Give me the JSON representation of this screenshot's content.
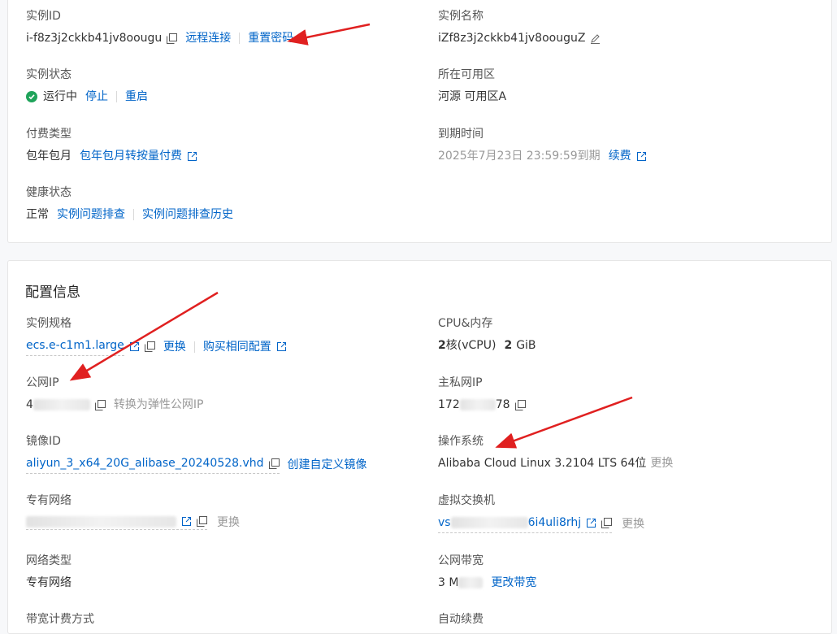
{
  "basic": {
    "instance_id": {
      "label": "实例ID",
      "value": "i-f8z3j2ckkb41jv8oougu",
      "remote_link": "远程连接",
      "reset_link": "重置密码"
    },
    "instance_name": {
      "label": "实例名称",
      "value": "iZf8z3j2ckkb41jv8oouguZ"
    },
    "status": {
      "label": "实例状态",
      "value": "运行中",
      "stop": "停止",
      "restart": "重启",
      "ok_color": "#1fa35a"
    },
    "zone": {
      "label": "所在可用区",
      "value": "河源 可用区A"
    },
    "billing": {
      "label": "付费类型",
      "value": "包年包月",
      "convert_link": "包年包月转按量付费"
    },
    "expire": {
      "label": "到期时间",
      "value": "2025年7月23日 23:59:59到期",
      "renew_link": "续费"
    },
    "health": {
      "label": "健康状态",
      "value": "正常",
      "diagnose_link": "实例问题排查",
      "history_link": "实例问题排查历史"
    }
  },
  "config": {
    "title": "配置信息",
    "spec": {
      "label": "实例规格",
      "value": "ecs.e-c1m1.large",
      "change": "更换",
      "buy_same": "购买相同配置"
    },
    "cpu_mem": {
      "label": "CPU&内存",
      "cpu_num": "2",
      "cpu_unit": "核(vCPU)",
      "mem_num": "2",
      "mem_unit": "GiB"
    },
    "public_ip": {
      "label": "公网IP",
      "value_prefix": "4",
      "convert": "转换为弹性公网IP"
    },
    "private_ip": {
      "label": "主私网IP",
      "value_prefix": "172",
      "value_suffix": "78"
    },
    "image_id": {
      "label": "镜像ID",
      "value": "aliyun_3_x64_20G_alibase_20240528.vhd",
      "create_link": "创建自定义镜像"
    },
    "os": {
      "label": "操作系统",
      "value": "Alibaba Cloud Linux 3.2104 LTS 64位",
      "change": "更换"
    },
    "vpc": {
      "label": "专有网络",
      "change": "更换"
    },
    "vswitch": {
      "label": "虚拟交换机",
      "value_prefix": "vs",
      "value_suffix": "6i4uli8rhj",
      "change": "更换"
    },
    "net_type": {
      "label": "网络类型",
      "value": "专有网络"
    },
    "bandwidth": {
      "label": "公网带宽",
      "value_prefix": "3 M",
      "change_link": "更改带宽"
    },
    "bw_billing": {
      "label": "带宽计费方式"
    },
    "auto_renew": {
      "label": "自动续费"
    }
  },
  "colors": {
    "link": "#0064c8",
    "arrow": "#e02020"
  }
}
